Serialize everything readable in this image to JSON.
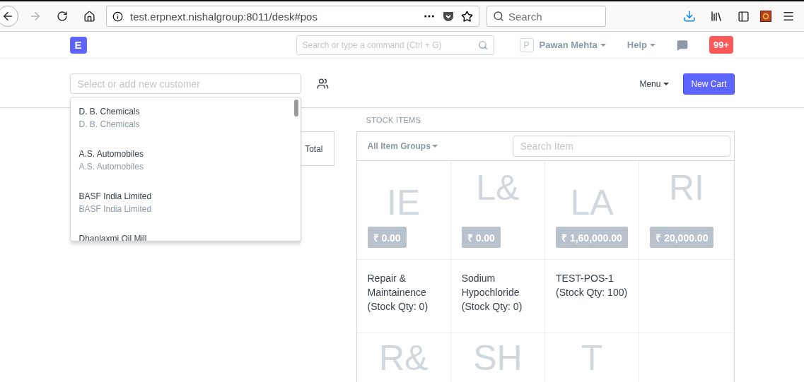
{
  "browser": {
    "url": "test.erpnext.nishalgroup:8011/desk#pos",
    "search_placeholder": "Search"
  },
  "navbar": {
    "logo": "E",
    "search_placeholder": "Search or type a command (Ctrl + G)",
    "user_initial": "P",
    "user": "Pawan Mehta",
    "help": "Help",
    "notifications": "99+"
  },
  "pos": {
    "customer_placeholder": "Select or add new customer",
    "menu": "Menu",
    "new_cart": "New Cart"
  },
  "customer_dropdown": [
    {
      "name": "D. B. Chemicals",
      "subtitle": "D. B. Chemicals"
    },
    {
      "name": "A.S. Automobiles",
      "subtitle": "A.S. Automobiles"
    },
    {
      "name": "BASF India Limited",
      "subtitle": "BASF India Limited"
    },
    {
      "name": "Dhanlaxmi Oil Mill"
    }
  ],
  "cart": {
    "column": "Total"
  },
  "stock": {
    "title": "STOCK ITEMS",
    "group": "All Item Groups",
    "search_placeholder": "Search Item",
    "cells": [
      {
        "kind": "tile",
        "initials": "IE",
        "price": "₹ 0.00",
        "raised": false
      },
      {
        "kind": "tile",
        "initials": "L&",
        "price": "₹ 0.00",
        "raised": true
      },
      {
        "kind": "tile",
        "initials": "LA",
        "price": "₹ 1,60,000.00",
        "raised": false
      },
      {
        "kind": "tile",
        "initials": "RI",
        "price": "₹ 20,000.00",
        "raised": true
      },
      {
        "kind": "name",
        "text": "Repair & Maintainence (Stock Qty: 0)"
      },
      {
        "kind": "name",
        "text": "Sodium Hypochloride (Stock Qty: 0)"
      },
      {
        "kind": "name",
        "text": "TEST-POS-1 (Stock Qty: 100)"
      },
      {
        "kind": "empty"
      },
      {
        "kind": "partial",
        "initials": "R&"
      },
      {
        "kind": "partial",
        "initials": "SH"
      },
      {
        "kind": "partial",
        "initials": "T"
      },
      {
        "kind": "empty"
      }
    ]
  }
}
